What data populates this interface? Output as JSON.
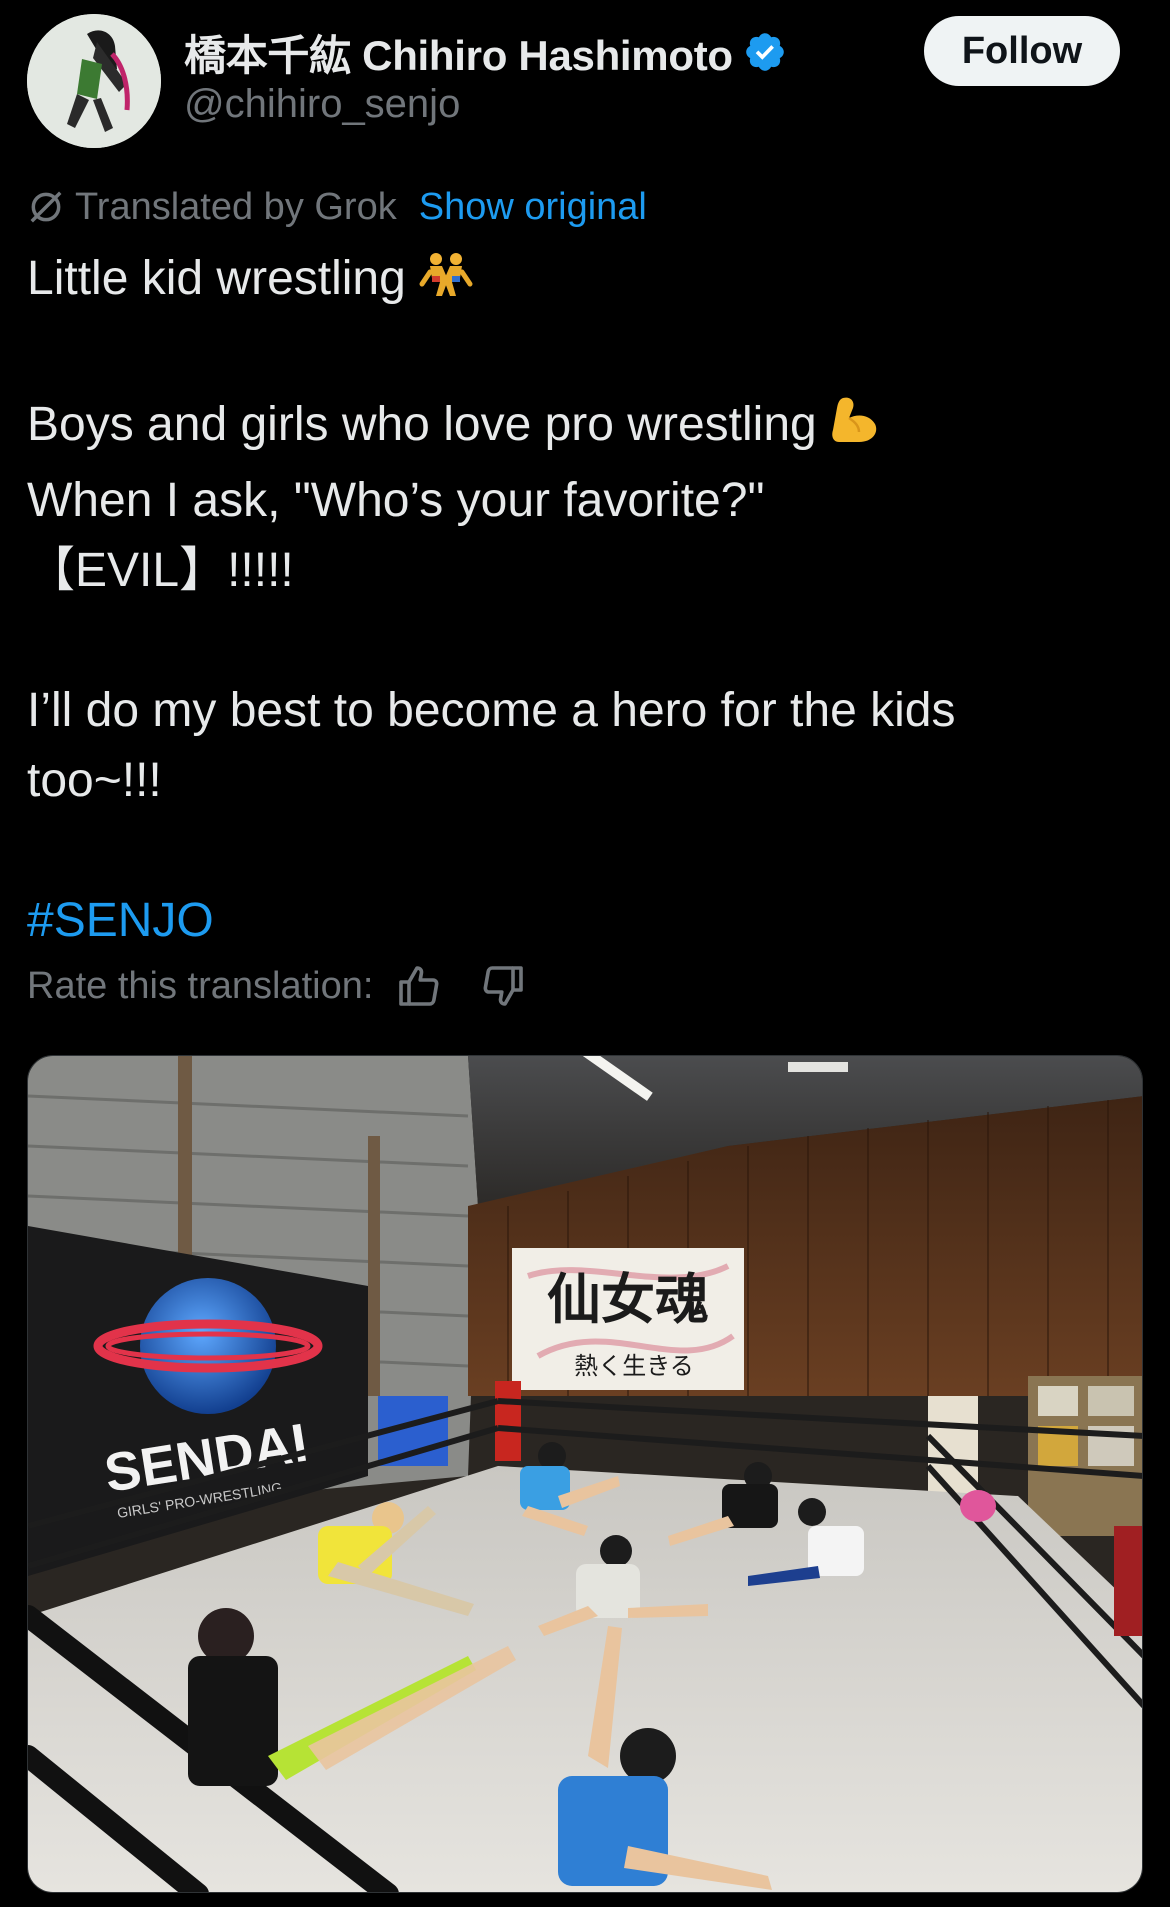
{
  "author": {
    "display_name": "橋本千紘 Chihiro Hashimoto",
    "handle": "@chihiro_senjo",
    "verified": true,
    "avatar_icon": "wrestler-avatar"
  },
  "follow_button": {
    "label": "Follow"
  },
  "translation": {
    "label": "Translated by Grok",
    "show_original": "Show original",
    "icon": "grok-icon"
  },
  "tweet": {
    "lines": [
      "Little kid wrestling",
      "",
      "Boys and girls who love pro wrestling",
      "When I ask, \"Who’s your favorite?\"",
      "【EVIL】!!!!!",
      "",
      "I’ll do my best to become a hero for the kids",
      "too~!!!",
      ""
    ],
    "hashtag": "#SENJO",
    "emojis": [
      "wrestlers-emoji",
      "flexed-biceps-emoji"
    ]
  },
  "rating": {
    "label": "Rate this translation:",
    "up_icon": "thumbs-up-icon",
    "down_icon": "thumbs-down-icon"
  },
  "media": {
    "description_icon": "photo",
    "banner_text": "SENDAI",
    "banner_subtext": "GIRLS' PRO-WRESTLING",
    "calligraphy_main": "仙女魂",
    "calligraphy_sub": "熱く生きる"
  },
  "colors": {
    "background": "#000000",
    "text": "#e7e9ea",
    "secondary": "#71767b",
    "accent": "#1d9bf0",
    "follow_bg": "#eff3f4"
  }
}
